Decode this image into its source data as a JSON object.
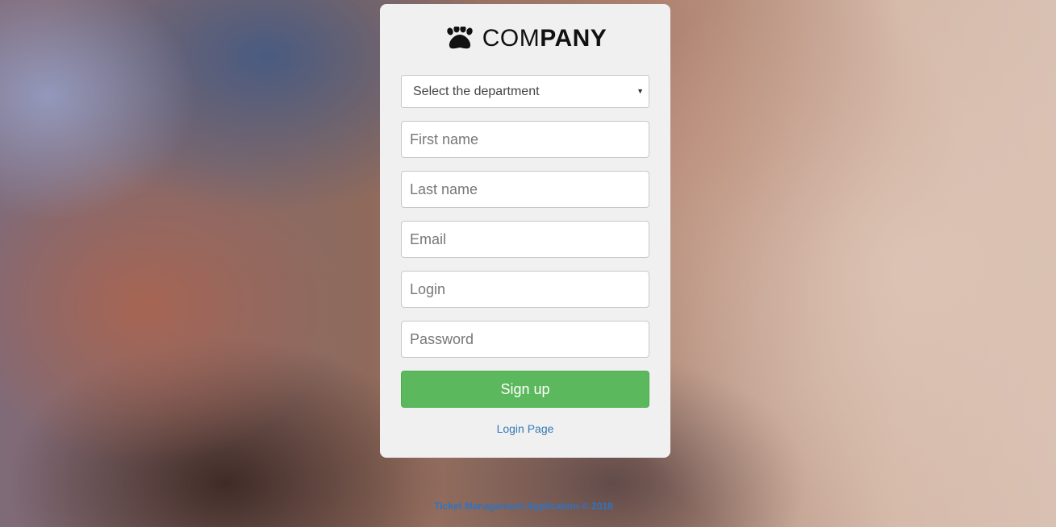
{
  "brand": {
    "logo_icon": "paw-icon",
    "name_light": "COM",
    "name_bold": "PANY"
  },
  "form": {
    "department_select": {
      "selected": "Select the department"
    },
    "first_name": {
      "placeholder": "First name",
      "value": ""
    },
    "last_name": {
      "placeholder": "Last name",
      "value": ""
    },
    "email": {
      "placeholder": "Email",
      "value": ""
    },
    "login": {
      "placeholder": "Login",
      "value": ""
    },
    "password": {
      "placeholder": "Password",
      "value": ""
    },
    "submit_label": "Sign up",
    "login_link": "Login Page"
  },
  "footer": {
    "text": "Ticket Management Application © 2018"
  },
  "colors": {
    "card_background": "#f0f0f0",
    "submit_button": "#5cb85c",
    "link": "#337ab7",
    "footer_text": "#2d74c4"
  }
}
